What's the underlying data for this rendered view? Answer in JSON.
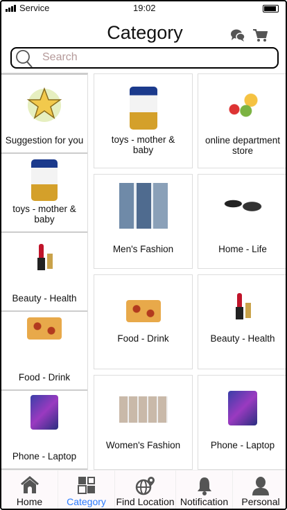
{
  "status": {
    "carrier": "Service",
    "time": "19:02"
  },
  "header": {
    "title": "Category",
    "icons": [
      "chat-icon",
      "cart-icon"
    ]
  },
  "search": {
    "placeholder": "Search"
  },
  "sidebar": {
    "items": [
      {
        "label": "Suggestion for you",
        "icon": "star-icon"
      },
      {
        "label": "toys - mother & baby",
        "icon": "milk-can-image"
      },
      {
        "label": "Beauty - Health",
        "icon": "lipstick-image"
      },
      {
        "label": "Food - Drink",
        "icon": "pizza-image"
      },
      {
        "label": "Phone - Laptop",
        "icon": "phone-image"
      }
    ]
  },
  "grid": {
    "items": [
      {
        "label": "toys - mother & baby"
      },
      {
        "label": "online department store"
      },
      {
        "label": "Men's Fashion"
      },
      {
        "label": "Home - Life"
      },
      {
        "label": "Food - Drink"
      },
      {
        "label": "Beauty - Health"
      },
      {
        "label": "Women's Fashion"
      },
      {
        "label": "Phone - Laptop"
      }
    ]
  },
  "nav": {
    "items": [
      {
        "label": "Home"
      },
      {
        "label": "Category",
        "active": true
      },
      {
        "label": "Find Location"
      },
      {
        "label": "Notification"
      },
      {
        "label": "Personal"
      }
    ],
    "active_color": "#2a7bff"
  }
}
